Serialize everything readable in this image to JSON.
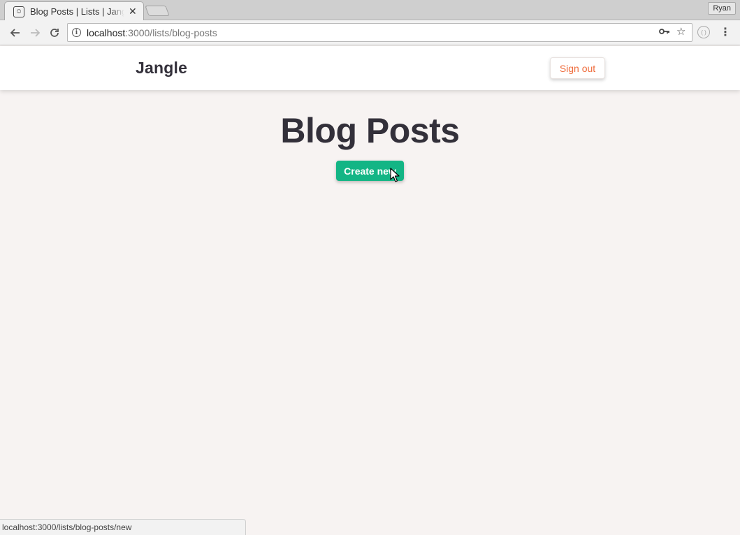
{
  "browser": {
    "tab_title": "Blog Posts | Lists | Jangle",
    "profile_name": "Ryan",
    "url_host": "localhost",
    "url_rest": ":3000/lists/blog-posts",
    "status_url": "localhost:3000/lists/blog-posts/new",
    "icons": {
      "back": "back-arrow-icon",
      "forward": "forward-arrow-icon",
      "reload": "reload-icon",
      "info": "info-icon",
      "key": "key-icon",
      "bookmark": "star-icon",
      "extension": "extension-icon",
      "menu": "kebab-menu-icon"
    }
  },
  "header": {
    "brand": "Jangle",
    "signout_label": "Sign out"
  },
  "main": {
    "title": "Blog Posts",
    "create_label": "Create new"
  },
  "colors": {
    "page_bg": "#f7f3f2",
    "accent_green": "#13b585",
    "signout_orange": "#ef6c3c",
    "text_dark": "#33303a"
  }
}
